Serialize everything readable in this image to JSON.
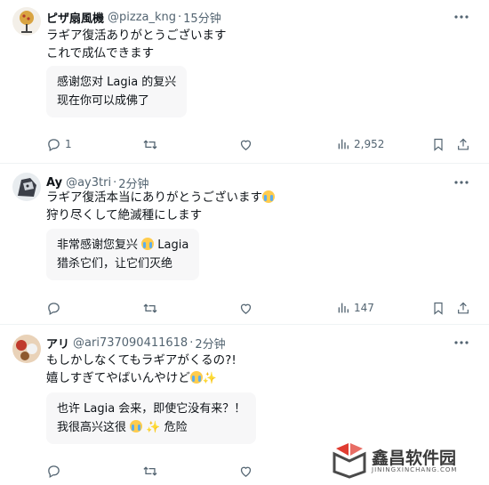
{
  "tweets": [
    {
      "name": "ピザ扇風機",
      "handle": "@pizza_kng",
      "dot": "·",
      "time": "15分钟",
      "text_lines": [
        "ラギア復活ありがとうございます",
        "これで成仏できます"
      ],
      "translation_lines": [
        "感谢您对 Lagia 的复兴",
        "现在你可以成佛了"
      ],
      "replies": "1",
      "retweets": "",
      "likes": "",
      "views": "2,952"
    },
    {
      "name": "Ay",
      "handle": "@ay3tri",
      "dot": "·",
      "time": "2分钟",
      "text_lines": [
        "ラギア復活本当にありがとうございます",
        "狩り尽くして絶滅種にします"
      ],
      "translation_lines": [
        "非常感谢您复兴",
        "Lagia",
        "猎杀它们，让它们灭绝"
      ],
      "replies": "",
      "retweets": "",
      "likes": "",
      "views": "147"
    },
    {
      "name": "アリ",
      "handle": "@ari737090411618",
      "dot": "·",
      "time": "2分钟",
      "text_lines": [
        "もしかしなくてもラギアがくるの?!",
        "嬉しすぎてやばいんやけど"
      ],
      "translation_lines": [
        "也许 Lagia 会来，即使它没有来？！",
        "我很高兴这很",
        "危险"
      ],
      "replies": "",
      "retweets": "",
      "likes": "",
      "views": ""
    }
  ],
  "watermark": {
    "title": "鑫昌软件园",
    "subtitle": "JININGXINCHANG.COM"
  },
  "icons": {
    "more": "more-horizontal-icon",
    "reply": "reply-icon",
    "retweet": "retweet-icon",
    "like": "heart-icon",
    "views": "analytics-icon",
    "bookmark": "bookmark-icon",
    "share": "share-icon"
  },
  "colors": {
    "secondary_text": "#536471",
    "divider": "#eff3f4",
    "translation_bg": "#f7f7f8"
  }
}
